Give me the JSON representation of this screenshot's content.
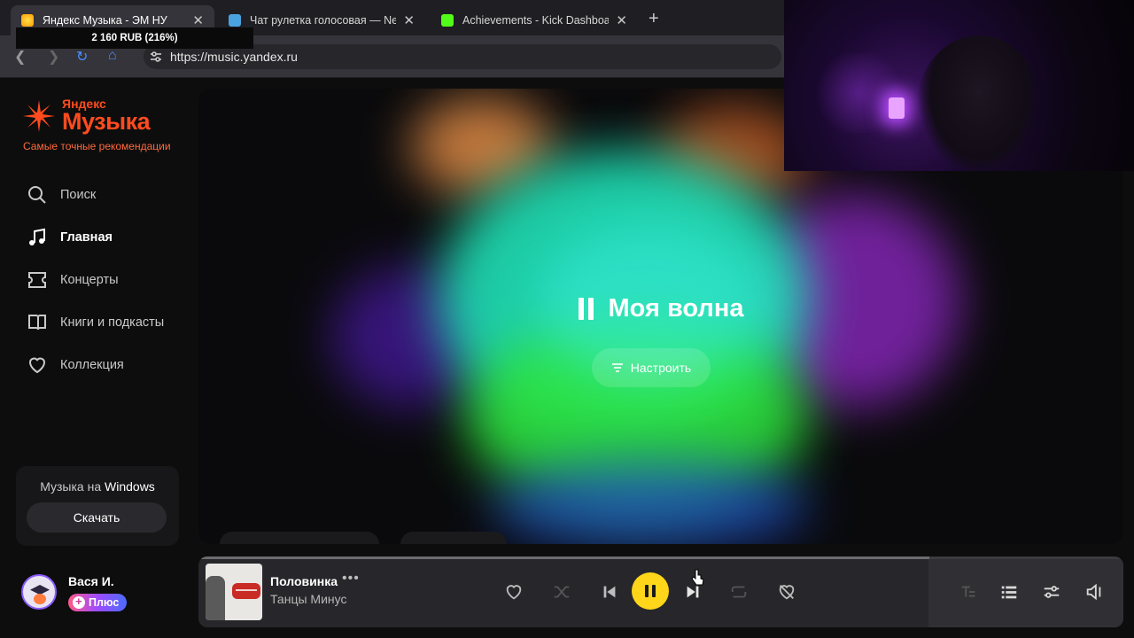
{
  "browser": {
    "tabs": [
      {
        "title": "Яндекс Музыка - ЭМ НУ",
        "active": true,
        "favicon_color": "#ffcc00"
      },
      {
        "title": "Чат рулетка голосовая — Nek",
        "active": false,
        "favicon_color": "#4aa3df"
      },
      {
        "title": "Achievements - Kick Dashboar",
        "active": false,
        "favicon_color": "#53fc18"
      }
    ],
    "new_tab_label": "+",
    "close_glyph": "✕",
    "price_overlay": "2 160 RUB (216%)",
    "url": "https://music.yandex.ru"
  },
  "logo": {
    "brand": "Яндекс",
    "name": "Музыка",
    "tagline": "Самые точные рекомендации",
    "color": "#ff4b1f"
  },
  "nav": {
    "items": [
      {
        "label": "Поиск",
        "icon": "search-icon",
        "active": false
      },
      {
        "label": "Главная",
        "icon": "music-note-icon",
        "active": true
      },
      {
        "label": "Концерты",
        "icon": "ticket-icon",
        "active": false
      },
      {
        "label": "Книги и подкасты",
        "icon": "book-icon",
        "active": false
      },
      {
        "label": "Коллекция",
        "icon": "heart-icon",
        "active": false
      }
    ]
  },
  "promo": {
    "text_prefix": "Музыка на ",
    "text_strong": "Windows",
    "button": "Скачать"
  },
  "user": {
    "name": "Вася И.",
    "plan": "Плюс"
  },
  "wave": {
    "title": "Моя волна",
    "tune_button": "Настроить"
  },
  "player": {
    "track_title": "Половинка",
    "more": "•••",
    "artist": "Танцы Минус",
    "progress_fraction": 0.79,
    "accent": "#ffd619"
  }
}
